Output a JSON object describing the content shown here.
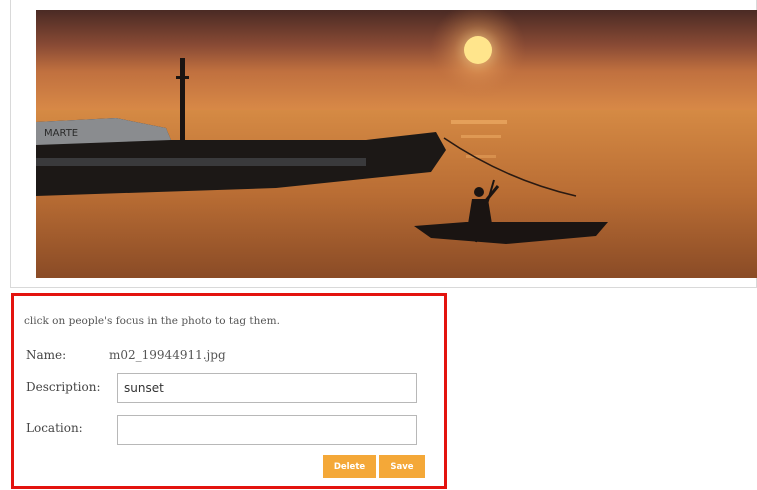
{
  "photo": {
    "alt": "sunset boat photo",
    "boat_name": "MARTE"
  },
  "tag_panel": {
    "hint": "click on people's focus in the photo to tag them.",
    "name_label": "Name:",
    "name_value": "m02_19944911.jpg",
    "description_label": "Description:",
    "description_value": "sunset",
    "location_label": "Location:",
    "location_value": "",
    "delete_label": "Delete",
    "save_label": "Save",
    "highlight_color": "#e3130f",
    "button_color": "#f4a838"
  }
}
